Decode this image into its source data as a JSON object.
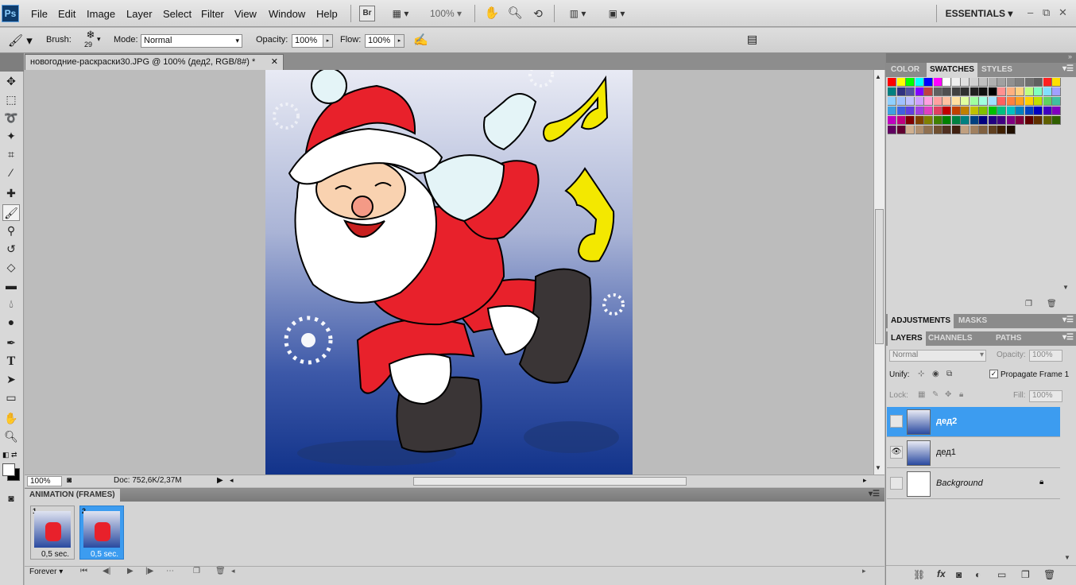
{
  "menubar": {
    "logo": "Ps",
    "menus": [
      "File",
      "Edit",
      "Image",
      "Layer",
      "Select",
      "Filter",
      "View",
      "Window",
      "Help"
    ],
    "bridge_label": "Br",
    "zoom": "100%",
    "workspace": "ESSENTIALS",
    "window_controls": {
      "minimize": "–",
      "restore": "⧉",
      "close": "✕"
    }
  },
  "options": {
    "brush_label": "Brush:",
    "brush_size": "29",
    "mode_label": "Mode:",
    "mode_value": "Normal",
    "opacity_label": "Opacity:",
    "opacity_value": "100%",
    "flow_label": "Flow:",
    "flow_value": "100%"
  },
  "document": {
    "tab_title": "новогодние-раскраски30.JPG @ 100% (дед2, RGB/8#) *",
    "tab_close": "✕"
  },
  "status": {
    "zoom": "100%",
    "doc_info": "Doc: 752,6K/2,37M"
  },
  "animation": {
    "title": "ANIMATION (FRAMES)",
    "frames": [
      {
        "number": "1",
        "delay": "0,5 sec."
      },
      {
        "number": "2",
        "delay": "0,5 sec."
      }
    ],
    "loop": "Forever"
  },
  "color_panel": {
    "tabs": [
      "COLOR",
      "SWATCHES",
      "STYLES"
    ],
    "active_tab": "SWATCHES"
  },
  "adjust_panel": {
    "tabs": [
      "ADJUSTMENTS",
      "MASKS"
    ]
  },
  "layers_panel": {
    "tabs": [
      "LAYERS",
      "CHANNELS",
      "PATHS"
    ],
    "blend_mode": "Normal",
    "opacity_label": "Opacity:",
    "opacity_value": "100%",
    "unify_label": "Unify:",
    "propagate_label": "Propagate Frame 1",
    "lock_label": "Lock:",
    "fill_label": "Fill:",
    "fill_value": "100%",
    "layers": [
      {
        "name": "дед2",
        "selected": true,
        "visible": false
      },
      {
        "name": "дед1",
        "selected": false,
        "visible": true
      },
      {
        "name": "Background",
        "selected": false,
        "visible": false
      }
    ]
  },
  "colors": {
    "accent": "#3c9cf0",
    "santa_red": "#e8212b",
    "note_yellow": "#f3e800",
    "boot": "#3a3536"
  }
}
